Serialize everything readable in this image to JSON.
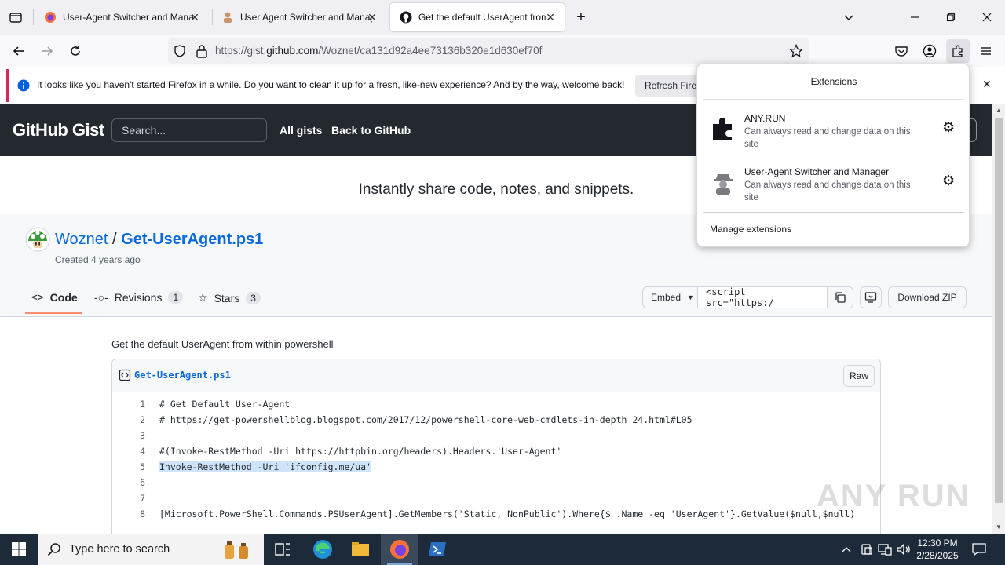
{
  "browser": {
    "tabs": [
      {
        "title": "User-Agent Switcher and Mana",
        "favicon": "firefox-icon"
      },
      {
        "title": "User Agent Switcher and Manag",
        "favicon": "spy-extension-icon"
      },
      {
        "title": "Get the default UserAgent from",
        "favicon": "github-icon",
        "active": true
      }
    ],
    "url_prefix": "https://gist.",
    "url_domain": "github.com",
    "url_path": "/Woznet/ca131d92a4ee73136b320e1d630ef70f",
    "notification": {
      "message": "It looks like you haven't started Firefox in a while. Do you want to clean it up for a fresh, like-new experience? And by the way, welcome back!",
      "button": "Refresh Firefo"
    }
  },
  "extensions_panel": {
    "title": "Extensions",
    "items": [
      {
        "name": "ANY.RUN",
        "desc": "Can always read and change data on this site"
      },
      {
        "name": "User-Agent Switcher and Manager",
        "desc": "Can always read and change data on this site"
      }
    ],
    "manage": "Manage extensions"
  },
  "github": {
    "logo": "GitHub Gist",
    "search_placeholder": "Search...",
    "nav": [
      "All gists",
      "Back to GitHub"
    ],
    "tagline": "Instantly share code, notes, and snippets.",
    "owner": "Woznet",
    "separator": "/",
    "gist_name": "Get-UserAgent.ps1",
    "created": "Created 4 years ago",
    "tabs": [
      {
        "label": "Code"
      },
      {
        "label": "Revisions",
        "count": "1"
      },
      {
        "label": "Stars",
        "count": "3"
      }
    ],
    "embed_label": "Embed",
    "embed_value": "<script src=\"https:/",
    "download_label": "Download ZIP",
    "description": "Get the default UserAgent from within powershell",
    "file_name": "Get-UserAgent.ps1",
    "raw_label": "Raw",
    "code": [
      {
        "n": "1",
        "text": "# Get Default User-Agent"
      },
      {
        "n": "2",
        "text": "# https://get-powershellblog.blogspot.com/2017/12/powershell-core-web-cmdlets-in-depth_24.html#L05"
      },
      {
        "n": "3",
        "text": ""
      },
      {
        "n": "4",
        "text": "#(Invoke-RestMethod -Uri https://httpbin.org/headers).Headers.'User-Agent'"
      },
      {
        "n": "5",
        "text": "Invoke-RestMethod -Uri 'ifconfig.me/ua'",
        "highlight": true
      },
      {
        "n": "6",
        "text": ""
      },
      {
        "n": "7",
        "text": ""
      },
      {
        "n": "8",
        "text": "[Microsoft.PowerShell.Commands.PSUserAgent].GetMembers('Static, NonPublic').Where{$_.Name -eq 'UserAgent'}.GetValue($null,$null)"
      }
    ]
  },
  "taskbar": {
    "search_placeholder": "Type here to search",
    "time": "12:30 PM",
    "date": "2/28/2025"
  },
  "watermark": "ANY RUN"
}
